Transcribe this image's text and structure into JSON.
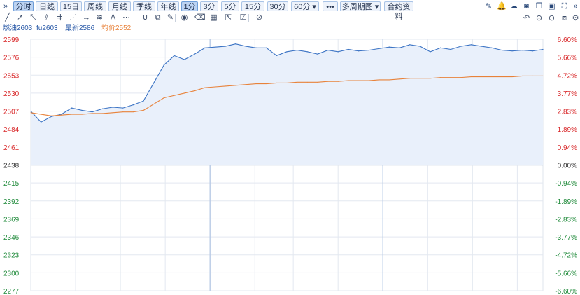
{
  "toolbar": {
    "expand_left": "»",
    "periods": [
      "分时",
      "日线",
      "15日",
      "周线",
      "月线",
      "季线",
      "年线",
      "1分",
      "3分",
      "5分",
      "15分",
      "30分",
      "60分 ▾",
      "•••",
      "多周期图 ▾",
      "合约资料"
    ],
    "active_periods": [
      "分时",
      "1分"
    ],
    "right_icons": [
      "pencil-icon",
      "bell-icon",
      "cloud-icon",
      "camera-icon",
      "copy-icon",
      "layout-icon",
      "fullscreen-icon",
      "expand-right-icon"
    ]
  },
  "draw_tools": [
    "line-tool-icon",
    "ray-tool-icon",
    "polyline-tool-icon",
    "parallel-tool-icon",
    "channel-tool-icon",
    "fan-tool-icon",
    "range-tool-icon",
    "fib-tool-icon",
    "text-tool-icon",
    "more-tools-icon",
    "magnet-icon",
    "lock-icon",
    "eraser-icon",
    "eye-icon",
    "delete-icon",
    "grid-icon",
    "export-icon",
    "check-icon",
    "ruler-icon"
  ],
  "chart_actions": [
    "undo-icon",
    "zoom-in-icon",
    "zoom-out-icon",
    "screenshot-icon",
    "settings-icon"
  ],
  "info": {
    "symbol": "燃油2603",
    "code": "fu2603",
    "latest": "最新2586",
    "average": "均价2552"
  },
  "colors": {
    "price_line": "#3b73c4",
    "price_fill": "#e9f0fb",
    "avg_line": "#e8823a",
    "up": "#d9292b",
    "down": "#1f8a3a",
    "neutral": "#333333",
    "grid": "#e3e8f0"
  },
  "chart_data": {
    "type": "line",
    "y_ticks_left": [
      "2599",
      "2576",
      "2553",
      "2530",
      "2507",
      "2484",
      "2461",
      "2438",
      "2415",
      "2392",
      "2369",
      "2346",
      "2323",
      "2300",
      "2277"
    ],
    "y_ticks_right": [
      "6.60%",
      "5.66%",
      "4.72%",
      "3.77%",
      "2.83%",
      "1.89%",
      "0.94%",
      "0.00%",
      "-0.94%",
      "-1.89%",
      "-2.83%",
      "-3.77%",
      "-4.72%",
      "-5.66%",
      "-6.60%"
    ],
    "ylim": [
      2277,
      2599
    ],
    "reference_price": 2438,
    "x": [
      0,
      0.02,
      0.04,
      0.06,
      0.08,
      0.1,
      0.12,
      0.14,
      0.16,
      0.18,
      0.2,
      0.22,
      0.24,
      0.26,
      0.28,
      0.3,
      0.32,
      0.34,
      0.36,
      0.38,
      0.4,
      0.42,
      0.44,
      0.46,
      0.48,
      0.5,
      0.52,
      0.54,
      0.56,
      0.58,
      0.6,
      0.62,
      0.64,
      0.66,
      0.68,
      0.7,
      0.72,
      0.74,
      0.76,
      0.78,
      0.8,
      0.82,
      0.84,
      0.86,
      0.88,
      0.9,
      0.92,
      0.94,
      0.96,
      0.98,
      1.0
    ],
    "series": [
      {
        "values": [
          2507,
          2493,
          2500,
          2503,
          2511,
          2508,
          2506,
          2510,
          2512,
          2511,
          2515,
          2520,
          2543,
          2566,
          2578,
          2573,
          2580,
          2588,
          2589,
          2590,
          2593,
          2590,
          2588,
          2588,
          2578,
          2583,
          2585,
          2583,
          2580,
          2585,
          2583,
          2586,
          2584,
          2585,
          2587,
          2589,
          2588,
          2592,
          2590,
          2583,
          2588,
          2586,
          2590,
          2592,
          2590,
          2588,
          2585,
          2584,
          2585,
          2584,
          2586
        ]
      },
      {
        "values": [
          2505,
          2503,
          2501,
          2502,
          2503,
          2503,
          2504,
          2504,
          2505,
          2506,
          2506,
          2508,
          2516,
          2524,
          2527,
          2530,
          2533,
          2537,
          2538,
          2539,
          2540,
          2541,
          2542,
          2542,
          2543,
          2543,
          2544,
          2544,
          2544,
          2545,
          2545,
          2546,
          2546,
          2546,
          2547,
          2547,
          2548,
          2549,
          2549,
          2549,
          2550,
          2550,
          2550,
          2551,
          2551,
          2551,
          2551,
          2551,
          2552,
          2552,
          2552
        ]
      }
    ],
    "grid": true
  }
}
